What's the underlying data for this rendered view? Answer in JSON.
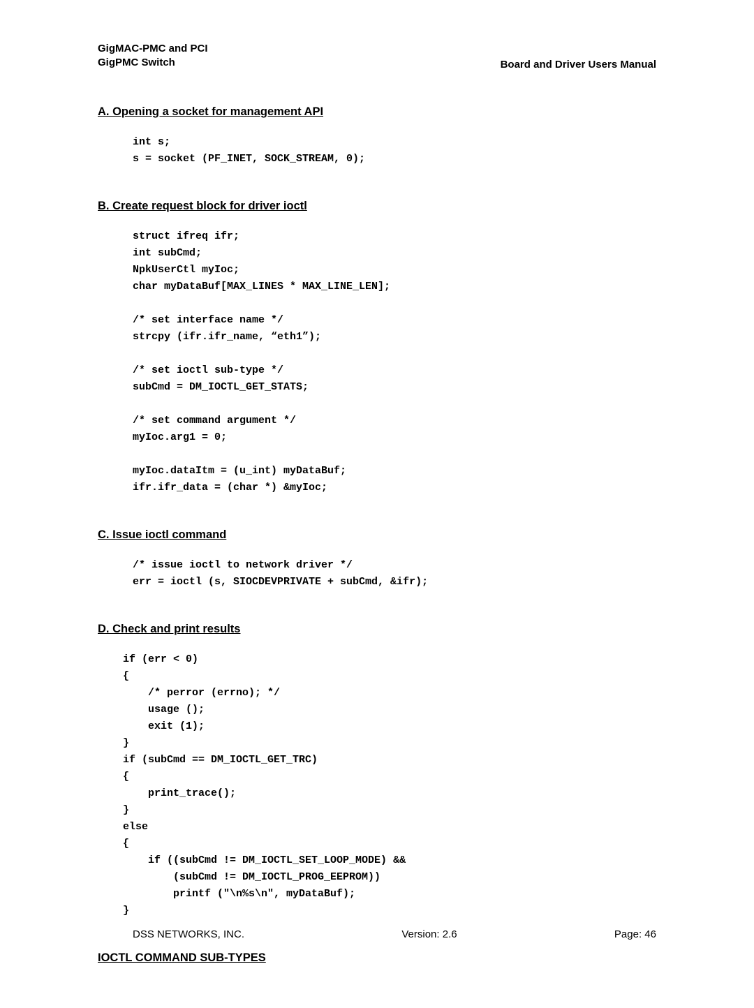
{
  "header": {
    "left_line1": "GigMAC-PMC and PCI",
    "left_line2": "GigPMC Switch",
    "right": "Board and Driver Users Manual"
  },
  "sections": {
    "a": {
      "heading": "A. Opening a socket for management API",
      "code": "int s;\ns = socket (PF_INET, SOCK_STREAM, 0);"
    },
    "b": {
      "heading": "B. Create request block for driver ioctl",
      "code": "struct ifreq ifr;\nint subCmd;\nNpkUserCtl myIoc;\nchar myDataBuf[MAX_LINES * MAX_LINE_LEN];\n\n/* set interface name */\nstrcpy (ifr.ifr_name, “eth1”);\n\n/* set ioctl sub-type */\nsubCmd = DM_IOCTL_GET_STATS;\n\n/* set command argument */\nmyIoc.arg1 = 0;\n\nmyIoc.dataItm = (u_int) myDataBuf;\nifr.ifr_data = (char *) &myIoc;"
    },
    "c": {
      "heading": "C. Issue ioctl command",
      "code": "/* issue ioctl to network driver */\nerr = ioctl (s, SIOCDEVPRIVATE + subCmd, &ifr);"
    },
    "d": {
      "heading": "D. Check and print results",
      "code": "if (err < 0)\n{\n    /* perror (errno); */\n    usage ();\n    exit (1);\n}\nif (subCmd == DM_IOCTL_GET_TRC)\n{\n    print_trace();\n}\nelse\n{\n    if ((subCmd != DM_IOCTL_SET_LOOP_MODE) &&\n        (subCmd != DM_IOCTL_PROG_EEPROM))\n        printf (\"\\n%s\\n\", myDataBuf);\n}"
    },
    "ioctl": {
      "heading": "IOCTL COMMAND SUB-TYPES"
    }
  },
  "footer": {
    "company": "DSS NETWORKS, INC.",
    "version": "Version: 2.6",
    "page": "Page: 46"
  }
}
